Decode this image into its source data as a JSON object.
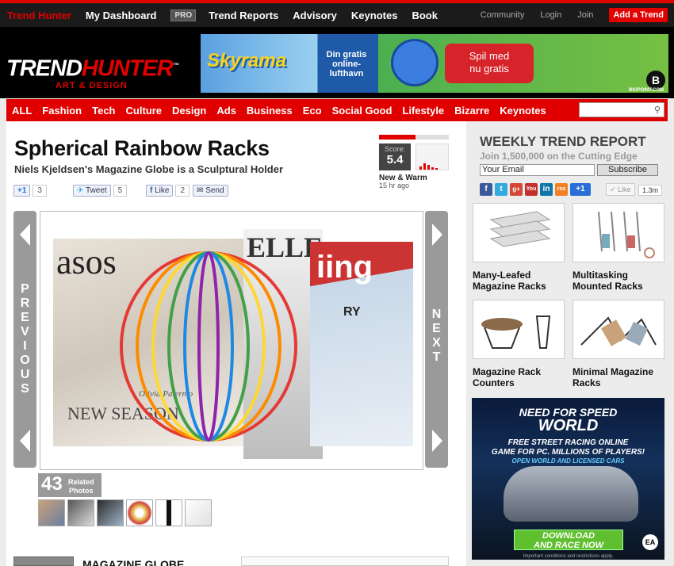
{
  "topnav": {
    "brand": "Trend Hunter",
    "dashboard": "My Dashboard",
    "pro": "PRO",
    "items": [
      "Trend Reports",
      "Advisory",
      "Keynotes",
      "Book"
    ],
    "community": "Community",
    "login": "Login",
    "join": "Join",
    "add_trend": "Add a Trend"
  },
  "logo": {
    "main_a": "TREND",
    "main_b": "HUNTER",
    "tm": "™",
    "sub": "ART & DESIGN"
  },
  "banner": {
    "brand": "Skyrama",
    "line1": "Din gratis",
    "line2": "online-lufthavn",
    "cta1": "Spil med",
    "cta2": "nu gratis",
    "badge": "B",
    "sponsor": "BIGPOINT.COM"
  },
  "categories": [
    "ALL",
    "Fashion",
    "Tech",
    "Culture",
    "Design",
    "Ads",
    "Business",
    "Eco",
    "Social Good",
    "Lifestyle",
    "Bizarre",
    "Keynotes"
  ],
  "search": {
    "placeholder": "",
    "icon": "search-icon"
  },
  "article": {
    "title": "Spherical Rainbow Racks",
    "subtitle": "Niels Kjeldsen's Magazine Globe is a Sculptural Holder",
    "score_label": "Score:",
    "score": "5.4",
    "score_level": 0.52,
    "status": "New & Warm",
    "age": "15 hr ago"
  },
  "share": {
    "gplus": "+1",
    "gplus_count": "3",
    "tweet": "Tweet",
    "tweet_count": "5",
    "like": "Like",
    "like_count": "2",
    "send": "Send"
  },
  "gallery": {
    "prev": "PREVIOUS",
    "next": "NEXT",
    "mag1_title": "asos",
    "mag1_line": "NEW SEASON",
    "mag1_name": "Olivia Palermo",
    "mag2_title": "ELLE",
    "mag3_title": "iing",
    "mag3_line": "RY",
    "photo_count": "43",
    "photo_label1": "Related",
    "photo_label2": "Photos"
  },
  "section2": {
    "title": "MAGAZINE GLOBE"
  },
  "sidebar": {
    "heading": "WEEKLY TREND REPORT",
    "join": "Join 1,500,000 on the Cutting Edge",
    "email_value": "Your Email",
    "subscribe": "Subscribe",
    "social": [
      "f",
      "t",
      "g+",
      "You",
      "in",
      "rss"
    ],
    "plus1": "+1",
    "like": "Like",
    "like_count": "1.3m",
    "cards": [
      {
        "caption": "Many-Leafed Magazine Racks"
      },
      {
        "caption": "Multitasking Mounted Racks"
      },
      {
        "caption": "Magazine Rack Counters"
      },
      {
        "caption": "Minimal Magazine Racks"
      }
    ]
  },
  "ad2": {
    "line1": "NEED FOR SPEED",
    "line2": "WORLD",
    "line3": "FREE STREET RACING ONLINE",
    "line4": "GAME FOR PC. MILLIONS OF PLAYERS!",
    "line5": "OPEN WORLD AND LICENSED CARS",
    "cta1": "DOWNLOAD",
    "cta2": "AND RACE NOW",
    "ea": "EA",
    "fine": "Important conditions and restrictions apply."
  },
  "colors": {
    "brand_red": "#e00000",
    "nav_dark": "#1b1b1b",
    "gallery_gray": "#9a9a9a"
  }
}
